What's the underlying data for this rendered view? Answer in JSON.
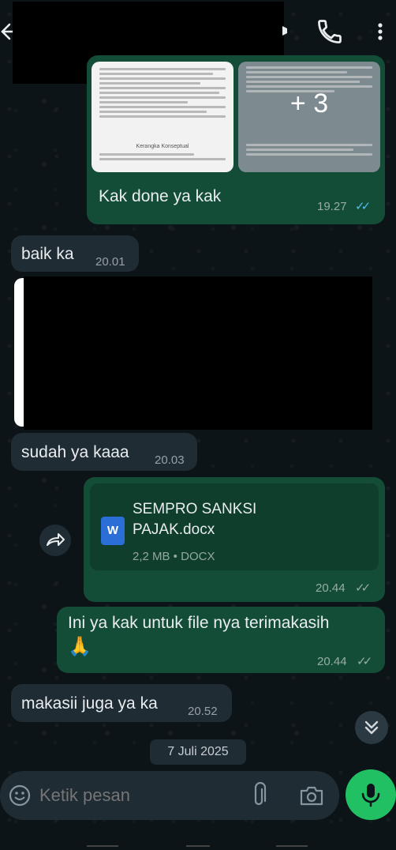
{
  "messages": {
    "m1": {
      "caption": "Kak done ya kak",
      "time": "19.27",
      "more_count": "+ 3"
    },
    "m2": {
      "text": "baik ka",
      "time": "20.01"
    },
    "m3": {
      "text": "sudah ya kaaa",
      "time": "20.03"
    },
    "m4": {
      "file_name_line1": "SEMPRO SANKSI",
      "file_name_line2": "PAJAK.docx",
      "file_meta": "2,2 MB • DOCX",
      "file_icon_letter": "W",
      "time": "20.44"
    },
    "m5": {
      "text": "Ini ya kak untuk file nya terimakasih",
      "emoji": "🙏",
      "time": "20.44"
    },
    "m6": {
      "text": "makasii juga ya ka",
      "time": "20.52"
    }
  },
  "date_chip": "7 Juli 2025",
  "input": {
    "placeholder": "Ketik pesan"
  },
  "doc_preview": {
    "heading": "Kerangka Konseptual",
    "caption": "Penelitian Penggunaan Sanksi Pajak"
  },
  "colors": {
    "outgoing": "#144d37",
    "incoming": "#1f2c33",
    "accent": "#21c063",
    "read_ticks": "#53bdeb"
  },
  "icons": [
    "back-arrow-icon",
    "phone-icon",
    "more-vert-icon",
    "forward-icon",
    "word-file-icon",
    "scroll-down-icon",
    "emoji-icon",
    "attach-icon",
    "camera-icon",
    "mic-icon"
  ]
}
